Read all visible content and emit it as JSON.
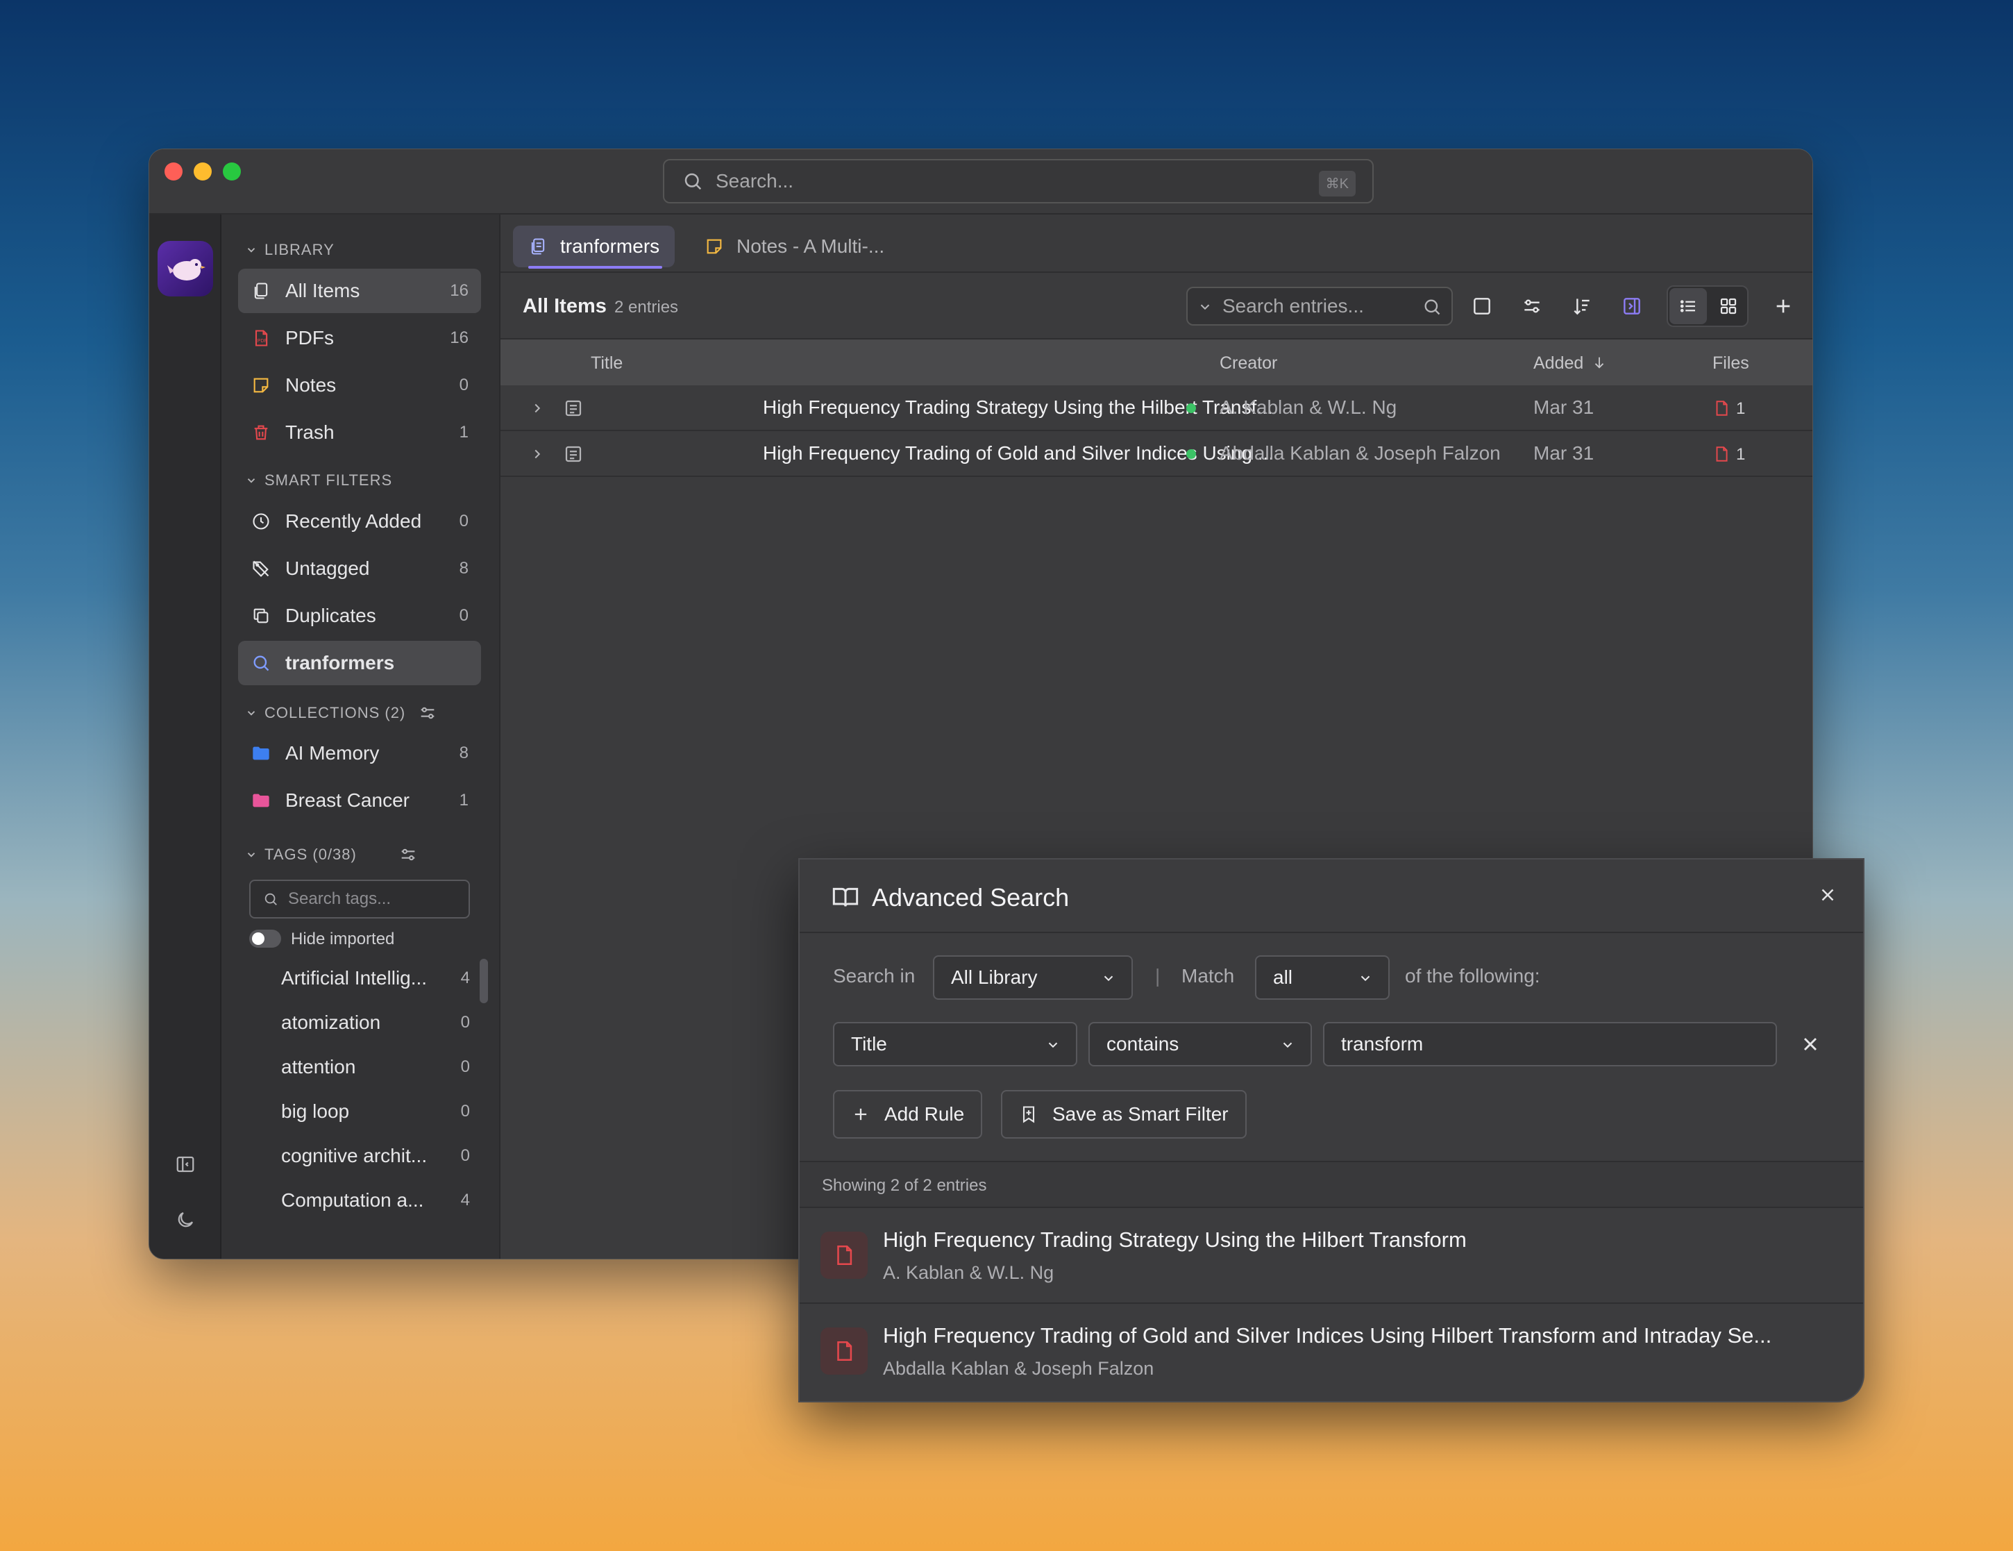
{
  "window": {
    "search_placeholder": "Search...",
    "search_shortcut": "⌘K"
  },
  "sidebar": {
    "library_header": "LIBRARY",
    "library_items": [
      {
        "label": "All Items",
        "count": "16"
      },
      {
        "label": "PDFs",
        "count": "16"
      },
      {
        "label": "Notes",
        "count": "0"
      },
      {
        "label": "Trash",
        "count": "1"
      }
    ],
    "smart_filters_header": "SMART FILTERS",
    "smart_filters": [
      {
        "label": "Recently Added",
        "count": "0"
      },
      {
        "label": "Untagged",
        "count": "8"
      },
      {
        "label": "Duplicates",
        "count": "0"
      },
      {
        "label": "tranformers",
        "count": ""
      }
    ],
    "collections_header": "COLLECTIONS (2)",
    "collections": [
      {
        "label": "AI Memory",
        "count": "8",
        "color": "#3d7ff0"
      },
      {
        "label": "Breast Cancer",
        "count": "1",
        "color": "#e8559a"
      }
    ],
    "tags_header": "TAGS (0/38)",
    "tag_search_placeholder": "Search tags...",
    "hide_imported_label": "Hide imported",
    "tags": [
      {
        "label": "Artificial Intellig...",
        "count": "4"
      },
      {
        "label": "atomization",
        "count": "0"
      },
      {
        "label": "attention",
        "count": "0"
      },
      {
        "label": "big loop",
        "count": "0"
      },
      {
        "label": "cognitive archit...",
        "count": "0"
      },
      {
        "label": "Computation a...",
        "count": "4"
      }
    ]
  },
  "tabs": [
    {
      "label": "tranformers",
      "active": true
    },
    {
      "label": "Notes - A Multi-...",
      "active": false
    }
  ],
  "toolbar": {
    "title": "All Items",
    "count": "2 entries",
    "search_placeholder": "Search entries..."
  },
  "table": {
    "columns": [
      "Title",
      "Creator",
      "Added",
      "Files"
    ],
    "rows": [
      {
        "title": "High Frequency Trading Strategy Using the Hilbert Transf...",
        "creator": "A. Kablan & W.L. Ng",
        "added": "Mar 31",
        "files": "1"
      },
      {
        "title": "High Frequency Trading of Gold and Silver Indices Using ...",
        "creator": "Abdalla Kablan & Joseph Falzon",
        "added": "Mar 31",
        "files": "1"
      }
    ]
  },
  "advanced_search": {
    "title": "Advanced Search",
    "search_in_label": "Search in",
    "search_in_value": "All Library",
    "separator": "|",
    "match_label": "Match",
    "match_value": "all",
    "following_label": "of the following:",
    "rule_field": "Title",
    "rule_operator": "contains",
    "rule_value": "transform",
    "add_rule_label": "Add Rule",
    "save_filter_label": "Save as Smart Filter",
    "results_summary": "Showing 2 of 2 entries",
    "results": [
      {
        "title": "High Frequency Trading Strategy Using the Hilbert Transform",
        "authors": "A. Kablan & W.L. Ng"
      },
      {
        "title": "High Frequency Trading of Gold and Silver Indices Using Hilbert Transform and Intraday Se...",
        "authors": "Abdalla Kablan & Joseph Falzon"
      }
    ]
  },
  "colors": {
    "accent": "#8d7cf5",
    "close": "#fe5f57",
    "minimize": "#febc2e",
    "maximize": "#28c840",
    "pdf_red": "#e5484d",
    "status_green": "#3cc266"
  }
}
